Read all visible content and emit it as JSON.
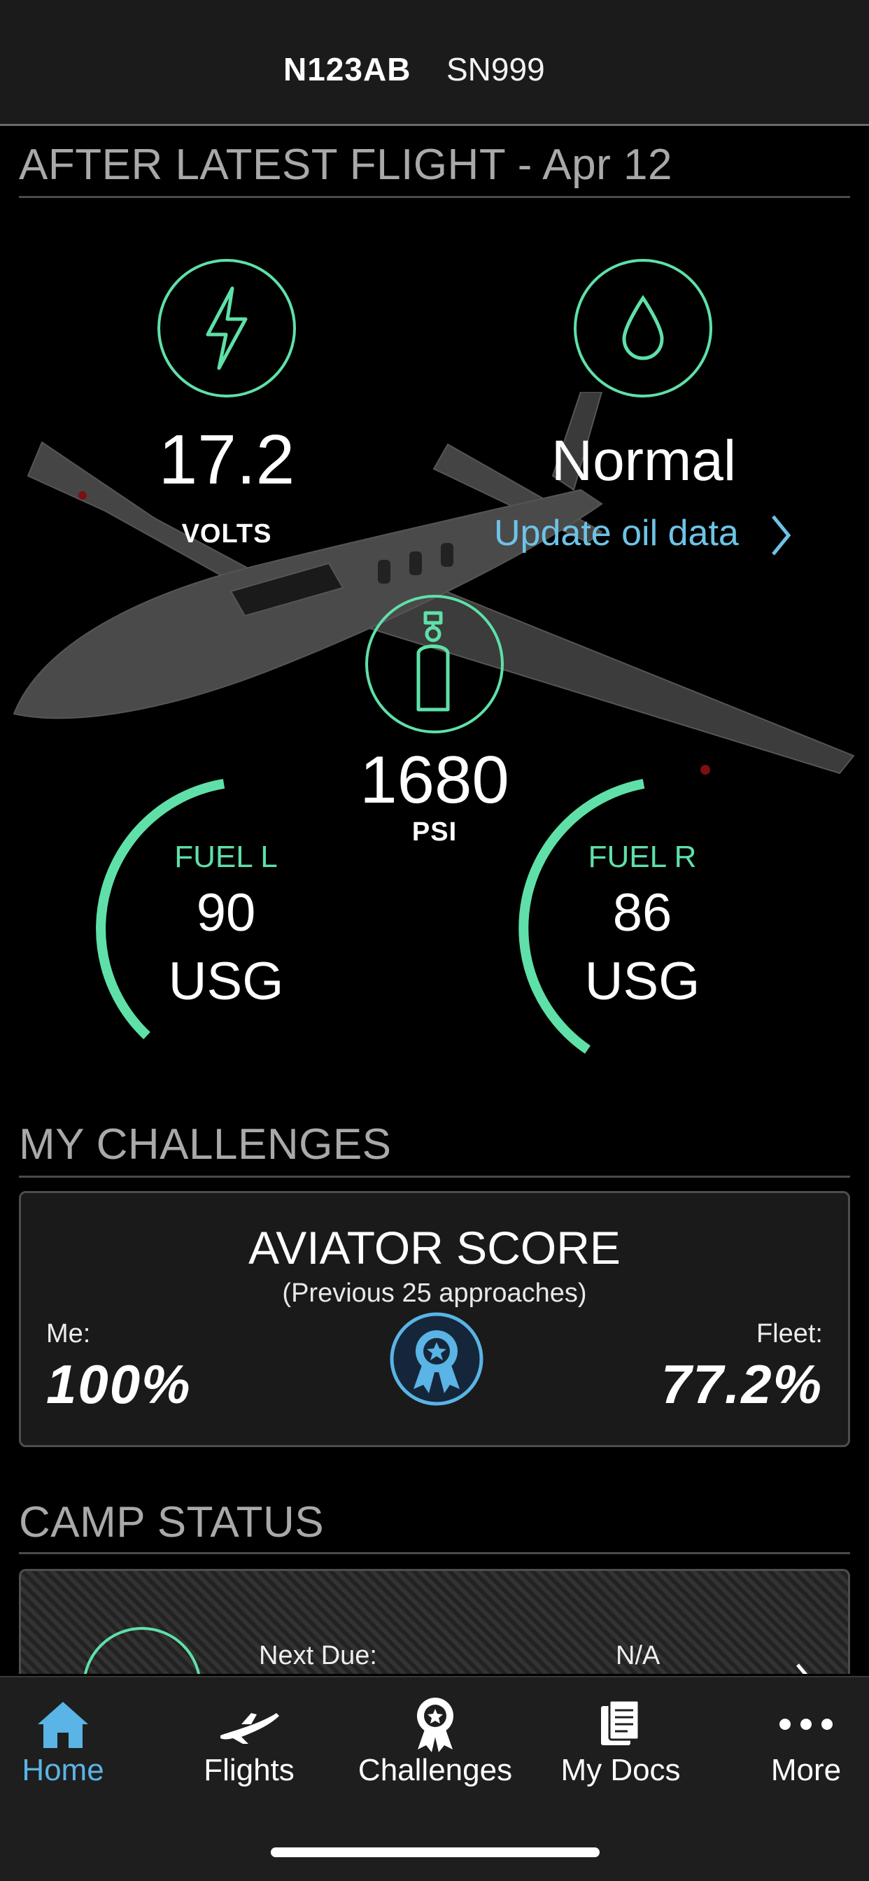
{
  "header": {
    "tail_number": "N123AB",
    "serial": "SN999"
  },
  "flight_section": {
    "title": "AFTER LATEST FLIGHT - Apr 12",
    "volts": {
      "icon": "lightning-bolt-icon",
      "value": "17.2",
      "unit": "VOLTS"
    },
    "oil": {
      "icon": "oil-drop-icon",
      "value": "Normal",
      "link": "Update oil data"
    },
    "oxygen": {
      "icon": "oxygen-bottle-icon",
      "value": "1680",
      "unit": "PSI"
    },
    "fuel_left": {
      "label": "FUEL L",
      "value": "90",
      "unit": "USG"
    },
    "fuel_right": {
      "label": "FUEL R",
      "value": "86",
      "unit": "USG"
    }
  },
  "challenges_section": {
    "title": "MY CHALLENGES",
    "card": {
      "title": "AVIATOR SCORE",
      "subtitle": "(Previous 25 approaches)",
      "me_label": "Me:",
      "me_value": "100%",
      "fleet_label": "Fleet:",
      "fleet_value": "77.2%",
      "icon": "award-ribbon-icon"
    }
  },
  "camp_section": {
    "title": "CAMP STATUS",
    "next_due_label": "Next Due:",
    "next_due_value": "N/A"
  },
  "tabbar": {
    "items": [
      {
        "label": "Home",
        "icon": "home-icon",
        "active": true
      },
      {
        "label": "Flights",
        "icon": "airplane-icon",
        "active": false
      },
      {
        "label": "Challenges",
        "icon": "award-icon",
        "active": false
      },
      {
        "label": "My Docs",
        "icon": "documents-icon",
        "active": false
      },
      {
        "label": "More",
        "icon": "more-dots-icon",
        "active": false
      }
    ]
  },
  "colors": {
    "accent_green": "#5fe0a8",
    "link_blue": "#6ec3e6",
    "tab_active": "#5ab4e5"
  }
}
